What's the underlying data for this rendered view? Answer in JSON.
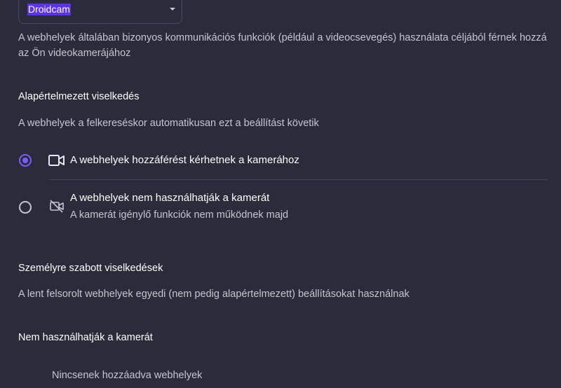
{
  "camera_select": {
    "selected": "Droidcam"
  },
  "intro": {
    "description": "A webhelyek általában bizonyos kommunikációs funkciók (például a videocsevegés) használata céljából férnek hozzá az Ön videokamerájához"
  },
  "default_behavior": {
    "title": "Alapértelmezett viselkedés",
    "description": "A webhelyek a felkereséskor automatikusan ezt a beállítást követik",
    "options": [
      {
        "label": "A webhelyek hozzáférést kérhetnek a kamerához",
        "sublabel": "",
        "checked": true,
        "icon": "camera-icon"
      },
      {
        "label": "A webhelyek nem használhatják a kamerát",
        "sublabel": "A kamerát igénylő funkciók nem működnek majd",
        "checked": false,
        "icon": "camera-off-icon"
      }
    ]
  },
  "custom_behavior": {
    "title": "Személyre szabott viselkedések",
    "description": "A lent felsorolt webhelyek egyedi (nem pedig alapértelmezett) beállításokat használnak"
  },
  "blocked": {
    "title": "Nem használhatják a kamerát",
    "empty_text": "Nincsenek hozzáadva webhelyek"
  },
  "colors": {
    "background": "#2b2b3b",
    "accent": "#7a5cff",
    "selection": "#5b32f0"
  }
}
